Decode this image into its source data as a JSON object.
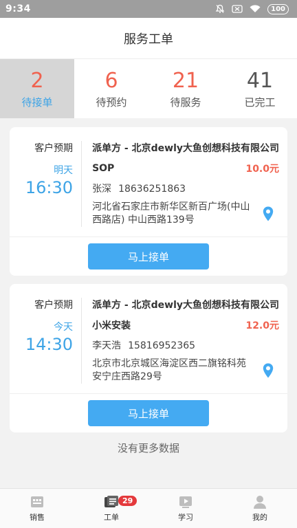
{
  "status_bar": {
    "time": "9:34",
    "battery": "100"
  },
  "header": {
    "title": "服务工单"
  },
  "tabs": [
    {
      "count": "2",
      "label": "待接单",
      "active": true
    },
    {
      "count": "6",
      "label": "待预约"
    },
    {
      "count": "21",
      "label": "待服务"
    },
    {
      "count": "41",
      "label": "已完工"
    }
  ],
  "orders": [
    {
      "expect_label": "客户预期",
      "day": "明天",
      "time": "16:30",
      "dispatch": "派单方 - 北京dewly大鱼创想科技有限公司",
      "service": "SOP",
      "price": "10.0元",
      "contact_name": "张深",
      "contact_phone": "18636251863",
      "address": "河北省石家庄市新华区新百广场(中山西路店) 中山西路139号",
      "button": "马上接单"
    },
    {
      "expect_label": "客户预期",
      "day": "今天",
      "time": "14:30",
      "dispatch": "派单方 - 北京dewly大鱼创想科技有限公司",
      "service": "小米安装",
      "price": "12.0元",
      "contact_name": "李天浩",
      "contact_phone": "15816952365",
      "address": "北京市北京城区海淀区西二旗铭科苑 安宁庄西路29号",
      "button": "马上接单"
    }
  ],
  "no_more": "没有更多数据",
  "bottom_nav": [
    {
      "label": "销售",
      "icon": "store-icon"
    },
    {
      "label": "工单",
      "icon": "workorder-icon",
      "badge": "29",
      "active": true
    },
    {
      "label": "学习",
      "icon": "study-icon"
    },
    {
      "label": "我的",
      "icon": "profile-icon"
    }
  ],
  "colors": {
    "accent": "#44aaf2",
    "red": "#f0624f",
    "status_bar": "#9e9e9e"
  }
}
